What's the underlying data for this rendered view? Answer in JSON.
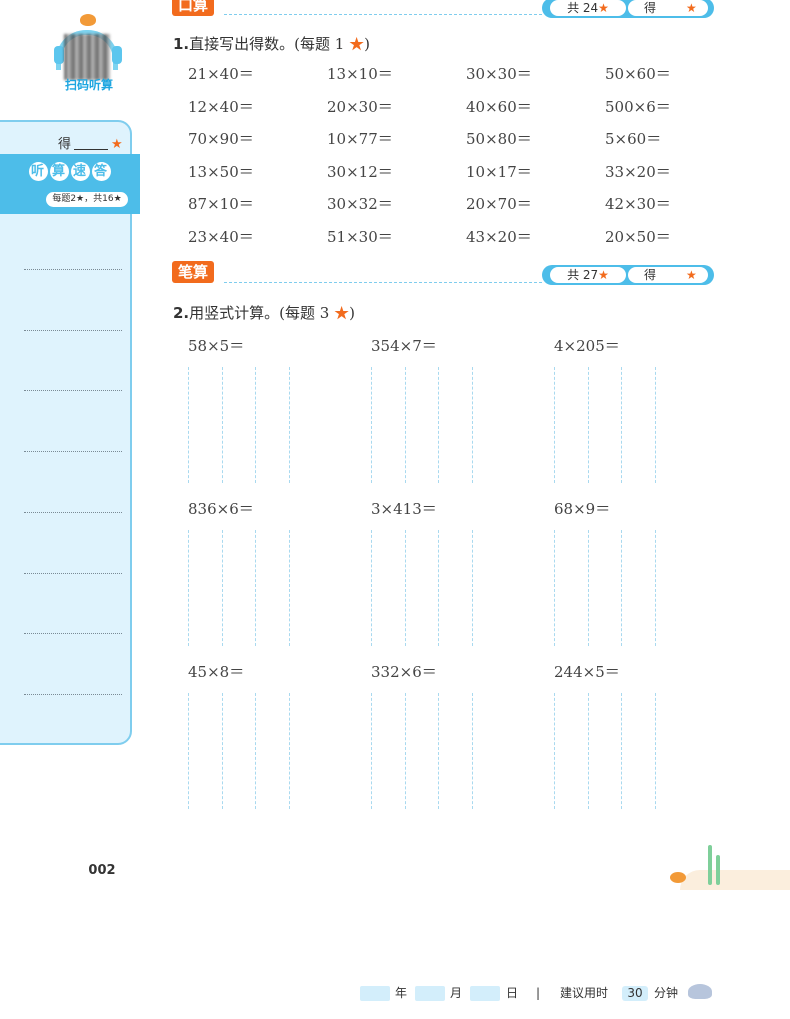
{
  "sidebar": {
    "qr_label": "扫码听算",
    "score_label": "得",
    "listen_title_chars": [
      "听",
      "算",
      "速",
      "答"
    ],
    "listen_sub": "每题2★，共16★",
    "dot_lines": 8
  },
  "section1": {
    "tag": "口算",
    "total_label": "共 24",
    "score_label": "得",
    "question_num": "1.",
    "question_text": "直接写出得数。(每题 1",
    "question_tail": ")",
    "problems": [
      "21×40＝",
      "13×10＝",
      "30×30＝",
      "50×60＝",
      "12×40＝",
      "20×30＝",
      "40×60＝",
      "500×6＝",
      "70×90＝",
      "10×77＝",
      "50×80＝",
      "5×60＝",
      "13×50＝",
      "30×12＝",
      "10×17＝",
      "33×20＝",
      "87×10＝",
      "30×32＝",
      "20×70＝",
      "42×30＝",
      "23×40＝",
      "51×30＝",
      "43×20＝",
      "20×50＝"
    ]
  },
  "section2": {
    "tag": "笔算",
    "total_label": "共 27",
    "score_label": "得",
    "question_num": "2.",
    "question_text": "用竖式计算。(每题 3",
    "question_tail": ")",
    "problems": [
      "58×5＝",
      "354×7＝",
      "4×205＝",
      "836×6＝",
      "3×413＝",
      "68×9＝",
      "45×8＝",
      "332×6＝",
      "244×5＝"
    ]
  },
  "footer": {
    "page_number": "002",
    "year_label": "年",
    "month_label": "月",
    "day_label": "日",
    "separator": "|",
    "suggest_label": "建议用时",
    "minutes": "30",
    "minutes_unit": "分钟"
  },
  "colors": {
    "accent_orange": "#f26b1d",
    "accent_blue": "#4dbde9",
    "panel_blue": "#dff3fd"
  }
}
